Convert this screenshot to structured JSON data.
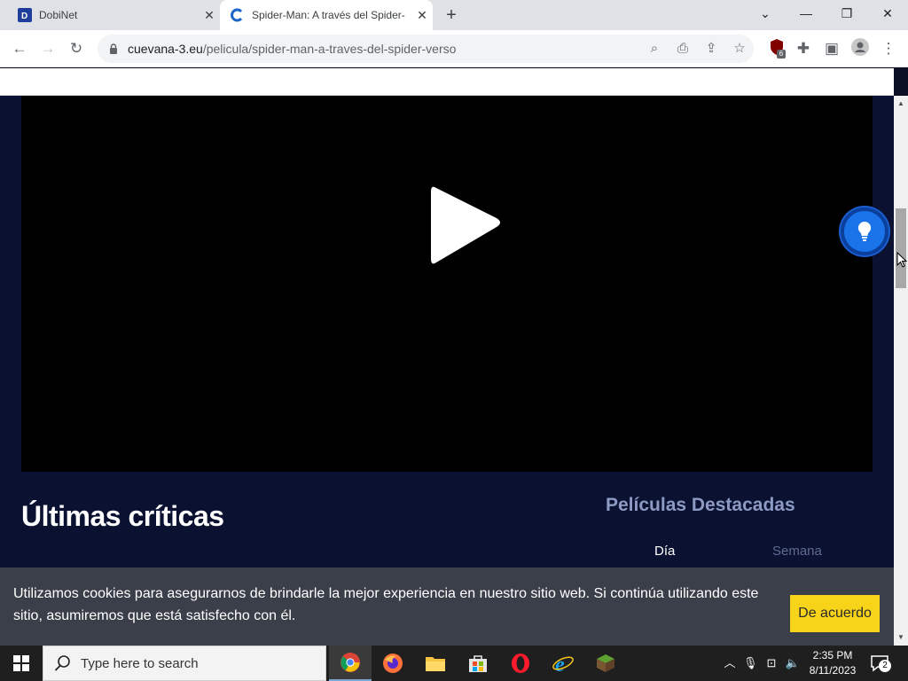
{
  "browser": {
    "tabs": [
      {
        "title": "DobiNet",
        "active": false,
        "icon": "dobinet-favicon"
      },
      {
        "title": "Spider-Man: A través del Spider-",
        "active": true,
        "icon": "cuevana-favicon"
      }
    ],
    "new_tab_label": "+",
    "address": {
      "domain": "cuevana-3.eu",
      "path": "/pelicula/spider-man-a-traves-del-spider-verso"
    },
    "extension_badge": "6"
  },
  "page": {
    "section_title": "Últimas críticas",
    "featured_title": "Películas Destacadas",
    "featured_tabs": [
      {
        "label": "Día",
        "active": true
      },
      {
        "label": "Semana",
        "active": false
      }
    ]
  },
  "cookie_banner": {
    "text": "Utilizamos cookies para asegurarnos de brindarle la mejor experiencia en nuestro sitio web. Si continúa utilizando este sitio, asumiremos que está satisfecho con él.",
    "accept_label": "De acuerdo"
  },
  "taskbar": {
    "search_placeholder": "Type here to search",
    "apps": [
      "chrome",
      "firefox",
      "file-explorer",
      "microsoft-store",
      "opera",
      "internet-explorer",
      "minecraft"
    ],
    "time": "2:35 PM",
    "date": "8/11/2023",
    "notification_count": "2"
  },
  "colors": {
    "page_bg": "#0b1130",
    "accent_button": "#f7d31a",
    "fab": "#1a73e8",
    "cookie_bg": "#3b3f4a"
  }
}
